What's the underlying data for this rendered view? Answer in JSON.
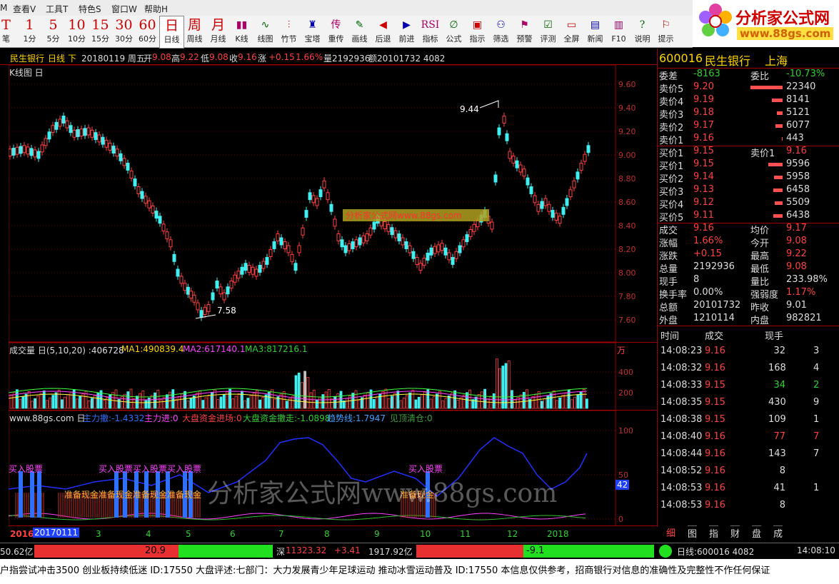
{
  "menu": [
    "M",
    "查看V",
    "工具T",
    "特色S",
    "窗口W",
    "帮助H"
  ],
  "toolbar": [
    {
      "big": "T",
      "sm": "笔"
    },
    {
      "big": "1",
      "sm": "1分"
    },
    {
      "big": "5",
      "sm": "5分"
    },
    {
      "big": "10",
      "sm": "10分"
    },
    {
      "big": "15",
      "sm": "15分"
    },
    {
      "big": "30",
      "sm": "30分"
    },
    {
      "big": "60",
      "sm": "60分"
    },
    {
      "big": "日",
      "sm": "日线"
    },
    {
      "big": "周",
      "sm": "周线"
    },
    {
      "big": "月",
      "sm": "月线"
    },
    {
      "big": "▮▮",
      "sm": "K线"
    },
    {
      "big": "∿",
      "sm": "线图"
    },
    {
      "big": "⫶",
      "sm": "竹节"
    },
    {
      "big": "♜",
      "sm": "宝塔"
    },
    {
      "big": "传",
      "sm": "重传"
    },
    {
      "big": "✎",
      "sm": "画线"
    },
    {
      "big": "◀",
      "sm": "后退"
    },
    {
      "big": "▶",
      "sm": "前进"
    },
    {
      "big": "RSI",
      "sm": "指标"
    },
    {
      "big": "∅",
      "sm": "公式"
    },
    {
      "big": "▣",
      "sm": "指示"
    },
    {
      "big": "⚇",
      "sm": "筛选"
    },
    {
      "big": "⚑",
      "sm": "预警"
    },
    {
      "big": "☑",
      "sm": "评测"
    },
    {
      "big": "▭",
      "sm": "全屏"
    },
    {
      "big": "▤",
      "sm": "新闻"
    },
    {
      "big": "▥",
      "sm": "F10"
    },
    {
      "big": "?",
      "sm": "说明"
    },
    {
      "big": "⚐",
      "sm": "提示"
    }
  ],
  "logo": {
    "title": "分析家公式网",
    "url": "www.88gs.com"
  },
  "info_bar": {
    "name": "民生银行",
    "period": "日线",
    "dir": "下",
    "date": "20180119 周五",
    "open_l": "开",
    "open": "9.08",
    "high_l": "高",
    "high": "9.22",
    "low_l": "低",
    "low": "9.08",
    "close_l": "收",
    "close": "9.16",
    "chg_l": "涨",
    "chg": "+0.15",
    "pct": "1.66%",
    "vol": "量2192936",
    "amt": "额20101732 4082"
  },
  "kline": {
    "title": "K线图 日",
    "yticks": [
      "9.60",
      "9.40",
      "9.20",
      "9.00",
      "8.80",
      "8.60",
      "8.40",
      "8.20",
      "8.00",
      "7.80",
      "7.60"
    ],
    "high_mark": "9.44",
    "low_mark": "7.58",
    "watermark": "分析家公式网www.88gs.com"
  },
  "volume": {
    "title": "成交量 日(5,10,20) :406728",
    "ma1": "MA1:490839.4",
    "ma2": "MA2:617140.1",
    "ma3": "MA3:817216.1",
    "unit": "万",
    "yticks": [
      "400",
      "200"
    ]
  },
  "indicator": {
    "title": "www.88gs.com 日",
    "s1": "主力撤:-1.4332",
    "s2": "主力进:0",
    "s3": "大盘资金进场:0",
    "s4": "大盘资金撤走:-1.0898",
    "s5": "趋势线:1.7947",
    "s6": "见顶清仓:0",
    "yticks": [
      "100",
      "50",
      "0"
    ],
    "cur": "42",
    "buy": "买入股票",
    "prep": "准备现金",
    "watermark": "分析家公式网www.88gs.com"
  },
  "xaxis": {
    "start": "2016",
    "sel": "20170111",
    "months": [
      "3",
      "4",
      "5",
      "6",
      "7",
      "8",
      "9",
      "10",
      "11",
      "12",
      "2018"
    ]
  },
  "quote": {
    "code": "600016",
    "name": "民生银行",
    "market": "上海",
    "weicha_l": "委差",
    "weicha": "-8163",
    "weibi_l": "委比",
    "weibi": "-10.73%",
    "asks": [
      {
        "l": "卖价5",
        "p": "9.20",
        "v": "22340"
      },
      {
        "l": "卖价4",
        "p": "9.19",
        "v": "8141"
      },
      {
        "l": "卖价3",
        "p": "9.18",
        "v": "5121"
      },
      {
        "l": "卖价2",
        "p": "9.17",
        "v": "6077"
      },
      {
        "l": "卖价1",
        "p": "9.16",
        "v": "443"
      }
    ],
    "bid1_l": "买价1",
    "bid1": "9.15",
    "ask1_l": "卖价1",
    "ask1": "9.16",
    "bids": [
      {
        "l": "买价1",
        "p": "9.15",
        "v": "9596"
      },
      {
        "l": "买价2",
        "p": "9.14",
        "v": "5958"
      },
      {
        "l": "买价3",
        "p": "9.13",
        "v": "6458"
      },
      {
        "l": "买价4",
        "p": "9.12",
        "v": "5509"
      },
      {
        "l": "买价5",
        "p": "9.11",
        "v": "6438"
      }
    ],
    "stats": [
      {
        "l1": "成交",
        "v1": "9.16",
        "c1": "r",
        "l2": "均价",
        "v2": "9.17",
        "c2": "r"
      },
      {
        "l1": "涨幅",
        "v1": "1.66%",
        "c1": "r",
        "l2": "今开",
        "v2": "9.08",
        "c2": "r"
      },
      {
        "l1": "涨跌",
        "v1": "+0.15",
        "c1": "r",
        "l2": "最高",
        "v2": "9.22",
        "c2": "r"
      },
      {
        "l1": "总量",
        "v1": "2192936",
        "c1": "w",
        "l2": "最低",
        "v2": "9.08",
        "c2": "r"
      },
      {
        "l1": "现手",
        "v1": "8",
        "c1": "w",
        "l2": "量比",
        "v2": "233.98%",
        "c2": "w"
      },
      {
        "l1": "换手率",
        "v1": "0.00%",
        "c1": "w",
        "l2": "强弱度",
        "v2": "1.17%",
        "c2": "r"
      },
      {
        "l1": "总额",
        "v1": "20101732",
        "c1": "w",
        "l2": "昨收",
        "v2": "9.01",
        "c2": "w"
      },
      {
        "l1": "外盘",
        "v1": "1210114",
        "c1": "w",
        "l2": "内盘",
        "v2": "982821",
        "c2": "w"
      }
    ],
    "tick_head": [
      "时间",
      "成交",
      "现手"
    ],
    "ticks": [
      {
        "t": "14:08:23",
        "p": "9.16",
        "pc": "r",
        "v": "32",
        "vc": "w",
        "x": "3"
      },
      {
        "t": "14:08:32",
        "p": "9.16",
        "pc": "r",
        "v": "168",
        "vc": "w",
        "x": "4"
      },
      {
        "t": "14:08:33",
        "p": "9.15",
        "pc": "r",
        "v": "34",
        "vc": "g",
        "x": "2"
      },
      {
        "t": "14:08:35",
        "p": "9.15",
        "pc": "r",
        "v": "430",
        "vc": "w",
        "x": "9"
      },
      {
        "t": "14:08:38",
        "p": "9.15",
        "pc": "r",
        "v": "109",
        "vc": "w",
        "x": "1"
      },
      {
        "t": "14:08:40",
        "p": "9.16",
        "pc": "r",
        "v": "77",
        "vc": "r",
        "x": "7"
      },
      {
        "t": "14:08:44",
        "p": "9.16",
        "pc": "r",
        "v": "143",
        "vc": "w",
        "x": "7"
      },
      {
        "t": "14:08:52",
        "p": "9.16",
        "pc": "r",
        "v": "8",
        "vc": "w",
        "x": ""
      },
      {
        "t": "14:08:53",
        "p": "9.16",
        "pc": "r",
        "v": "41",
        "vc": "w",
        "x": "1"
      },
      {
        "t": "14:08:53",
        "p": "9.16",
        "pc": "r",
        "v": "8",
        "vc": "w",
        "x": ""
      }
    ],
    "tabs": [
      "细",
      "图",
      "指",
      "财",
      "盘",
      "成"
    ]
  },
  "status": {
    "sh_amt": "50.62亿",
    "sh_bar": "20.9",
    "sz_l": "深",
    "sz": "11323.32",
    "sz_chg": "+3.41",
    "sz_amt": "1917.92亿",
    "sz_bar": "-9.1",
    "right": "日线:600016 4082",
    "time": "14:08:10"
  },
  "ticker": "户指尝试冲击3500 创业板持续低迷 ID:17550     大盘评述:七部门：大力发展青少年足球运动 推动冰雪运动普及 ID:17550     本信息仅供参考，招商银行对信息的准确性及完整性不作任何保证"
}
